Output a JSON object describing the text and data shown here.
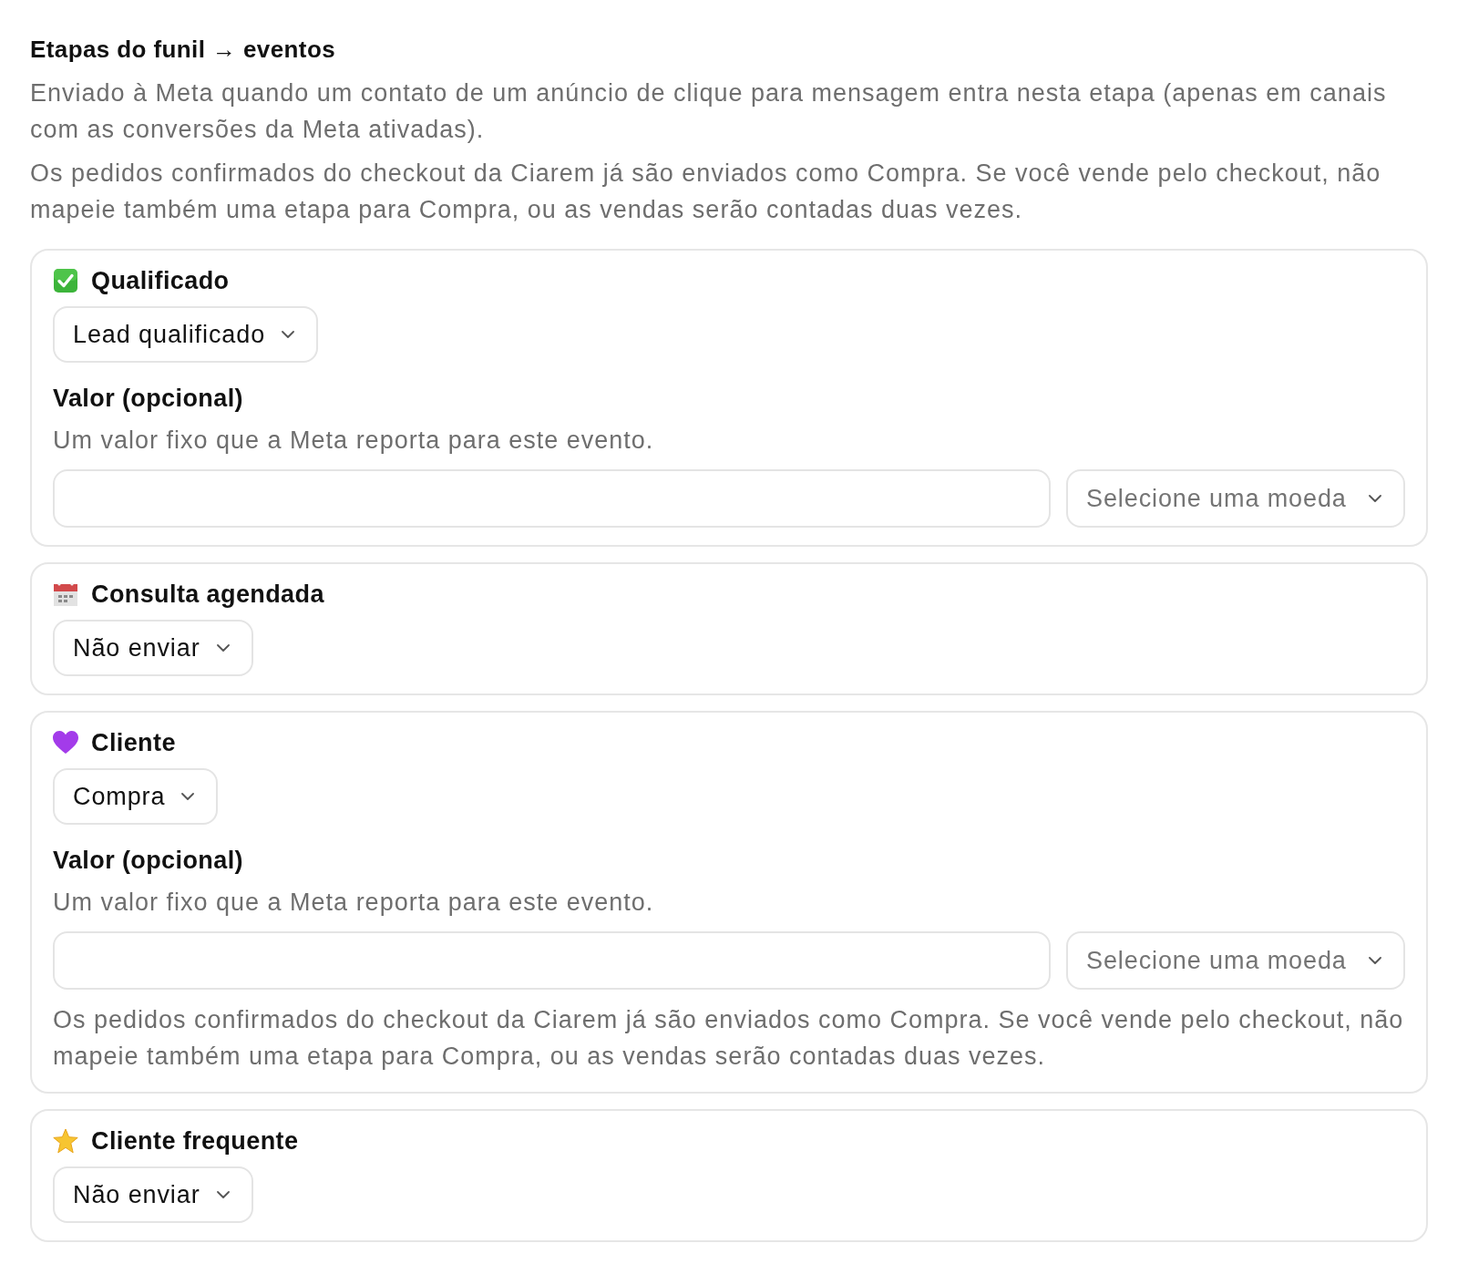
{
  "section": {
    "title": "Etapas do funil → eventos",
    "paragraphs": [
      "Enviado à Meta quando um contato de um anúncio de clique para mensagem entra nesta etapa (apenas em canais com as conversões da Meta ativadas).",
      "Os pedidos confirmados do checkout da Ciarem já são enviados como Compra. Se você vende pelo checkout, não mapeie também uma etapa para Compra, ou as vendas serão contadas duas vezes."
    ]
  },
  "stages": [
    {
      "name": "Qualificado",
      "event": "Lead qualificado",
      "value": {
        "label": "Valor (opcional)",
        "hint": "Um valor fixo que a Meta reporta para este evento.",
        "currency": {
          "placeholder": "Selecione uma moeda"
        }
      }
    },
    {
      "name": "Consulta agendada",
      "event": "Não enviar"
    },
    {
      "name": "Cliente",
      "event": "Compra",
      "value": {
        "label": "Valor (opcional)",
        "hint": "Um valor fixo que a Meta reporta para este evento.",
        "currency": {
          "placeholder": "Selecione uma moeda"
        }
      },
      "note": "Os pedidos confirmados do checkout da Ciarem já são enviados como Compra. Se você vende pelo checkout, não mapeie também uma etapa para Compra, ou as vendas serão contadas duas vezes."
    },
    {
      "name": "Cliente frequente",
      "event": "Não enviar"
    }
  ]
}
